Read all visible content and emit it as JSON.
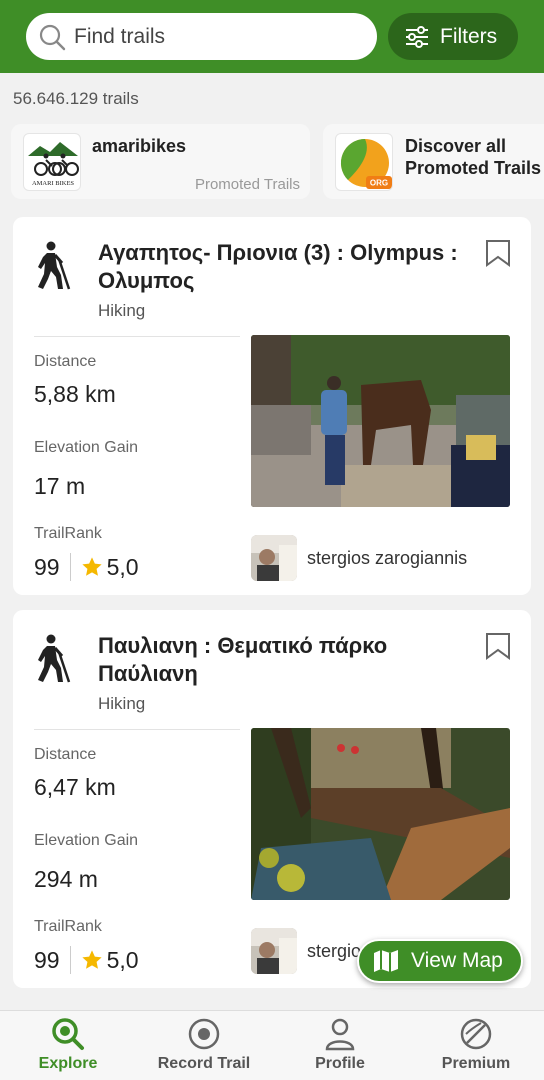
{
  "search": {
    "placeholder": "Find trails"
  },
  "filters": {
    "label": "Filters"
  },
  "trail_count": "56.646.129 trails",
  "promos": [
    {
      "title": "amaribikes",
      "subtitle": "Promoted Trails",
      "logo_text": "AMARI BIKES"
    },
    {
      "title": "Discover all Promoted Trails",
      "badge": "ORG"
    }
  ],
  "trails": [
    {
      "title": "Αγαπητος- Πριονια (3) : Olympus : Ολυμπος",
      "activity": "Hiking",
      "distance_label": "Distance",
      "distance": "5,88 km",
      "elevation_label": "Elevation Gain",
      "elevation": "17 m",
      "rank_label": "TrailRank",
      "rank": "99",
      "rating": "5,0",
      "author": "stergios zarogiannis"
    },
    {
      "title": "Παυλιανη : Θεματικό πάρκο Παύλιανη",
      "activity": "Hiking",
      "distance_label": "Distance",
      "distance": "6,47 km",
      "elevation_label": "Elevation Gain",
      "elevation": "294 m",
      "rank_label": "TrailRank",
      "rank": "99",
      "rating": "5,0",
      "author": "stergios zarogiannis"
    }
  ],
  "view_map": {
    "label": "View Map"
  },
  "tabs": [
    {
      "label": "Explore",
      "icon": "magnifier-icon",
      "active": true
    },
    {
      "label": "Record Trail",
      "icon": "record-icon",
      "active": false
    },
    {
      "label": "Profile",
      "icon": "person-icon",
      "active": false
    },
    {
      "label": "Premium",
      "icon": "premium-icon",
      "active": false
    }
  ],
  "colors": {
    "brand_green": "#3f8e27",
    "dark_green": "#2c661b",
    "star": "#f5b800"
  }
}
